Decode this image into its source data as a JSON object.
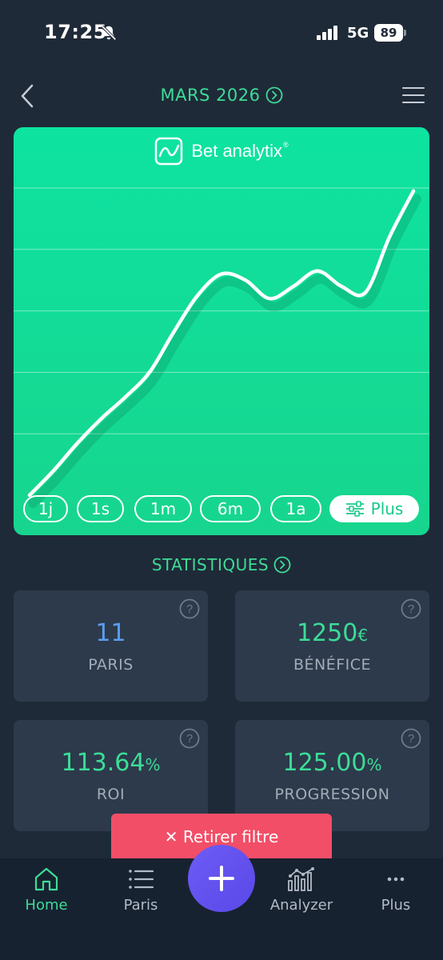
{
  "status": {
    "time": "17:25",
    "network": "5G",
    "battery": "89"
  },
  "header": {
    "title": "MARS 2026"
  },
  "chart": {
    "brand": "Bet analytix",
    "brand_mark": "®",
    "periods": [
      "1j",
      "1s",
      "1m",
      "6m",
      "1a"
    ],
    "more_label": "Plus",
    "colors": {
      "background": "#11dc9b",
      "line": "#ffffff"
    }
  },
  "chart_data": {
    "type": "line",
    "title": "",
    "xlabel": "",
    "ylabel": "",
    "grid": true,
    "series": [
      {
        "values": [
          0,
          8,
          17,
          25,
          32,
          40,
          53,
          65,
          72,
          70,
          64,
          68,
          73,
          68,
          66,
          84,
          99
        ]
      }
    ],
    "ylim": [
      0,
      100
    ]
  },
  "stats": {
    "title": "STATISTIQUES",
    "cards": [
      {
        "value": "11",
        "unit": "",
        "label": "PARIS",
        "color": "#5b9df0"
      },
      {
        "value": "1250",
        "unit": "€",
        "label": "BÉNÉFICE",
        "color": "#3ddc97"
      },
      {
        "value": "113.64",
        "unit": "%",
        "label": "ROI",
        "color": "#3ddc97"
      },
      {
        "value": "125.00",
        "unit": "%",
        "label": "PROGRESSION",
        "color": "#3ddc97"
      }
    ]
  },
  "filter": {
    "label": "✕ Retirer filtre"
  },
  "nav": {
    "items": [
      {
        "label": "Home",
        "icon": "home-icon"
      },
      {
        "label": "Paris",
        "icon": "list-icon"
      },
      {
        "label": "Analyzer",
        "icon": "bar-chart-icon"
      },
      {
        "label": "Plus",
        "icon": "more-icon"
      }
    ]
  }
}
